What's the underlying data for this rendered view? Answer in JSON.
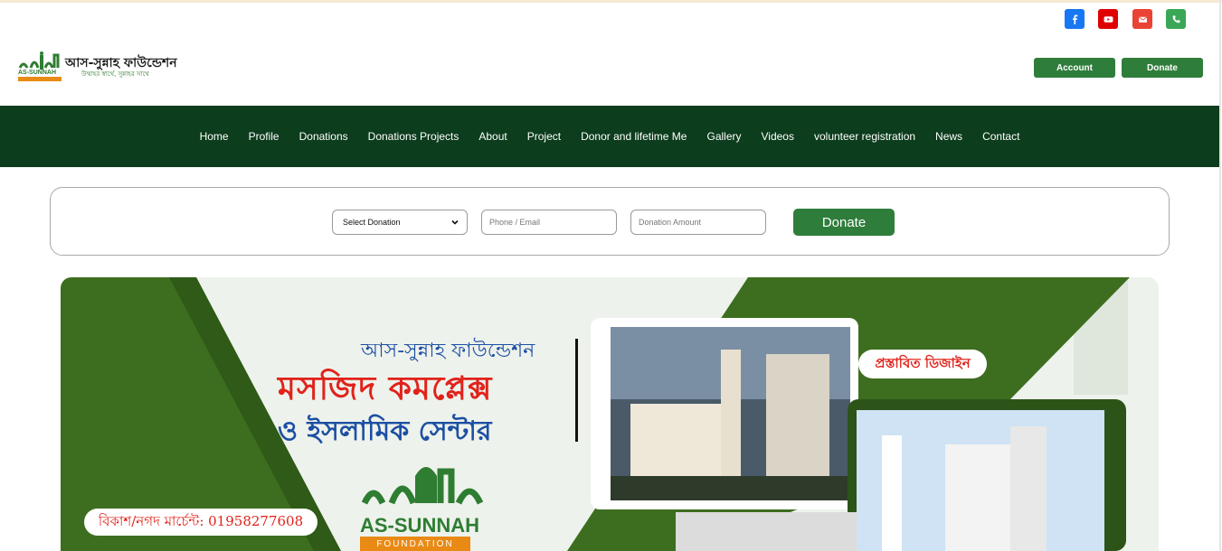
{
  "header": {
    "social": [
      {
        "icon": "facebook-icon",
        "color": "#1877f2"
      },
      {
        "icon": "youtube-icon",
        "color": "#e00000"
      },
      {
        "icon": "mail-icon",
        "color": "#ea4335"
      },
      {
        "icon": "phone-icon",
        "color": "#3aa757"
      }
    ],
    "logo": {
      "title": "আস-সুন্নাহ ফাউন্ডেশন",
      "tagline": "উম্মাহর স্বার্থে, সুন্নাহর সাথে",
      "name_en": "AS-SUNNAH",
      "sub_en": "FOUNDATION"
    },
    "account_label": "Account",
    "donate_label": "Donate"
  },
  "nav": {
    "items": [
      {
        "label": "Home"
      },
      {
        "label": "Profile"
      },
      {
        "label": "Donations"
      },
      {
        "label": "Donations Projects"
      },
      {
        "label": "About"
      },
      {
        "label": "Project"
      },
      {
        "label": "Donor and lifetime Me"
      },
      {
        "label": "Gallery"
      },
      {
        "label": "Videos"
      },
      {
        "label": "volunteer registration"
      },
      {
        "label": "News"
      },
      {
        "label": "Contact"
      }
    ]
  },
  "donation_form": {
    "select_value": "Select Donation",
    "phone_placeholder": "Phone / Email",
    "amount_placeholder": "Donation Amount",
    "submit_label": "Donate"
  },
  "banner": {
    "org_name": "আস-সুন্নাহ ফাউন্ডেশন",
    "headline": "মসজিদ কমপ্লেক্স",
    "subheadline": "ও ইসলামিক সেন্টার",
    "proposed_label": "প্রস্তাবিত ডিজাইন",
    "payment_line": "বিকাশ/নগদ মার্চেন্ট: 01958277608",
    "logo_name": "AS-SUNNAH",
    "logo_sub": "FOUNDATION"
  },
  "colors": {
    "nav_bg": "#0c3d1d",
    "button_green": "#2f7d3b",
    "banner_green": "#3d6e1f"
  }
}
